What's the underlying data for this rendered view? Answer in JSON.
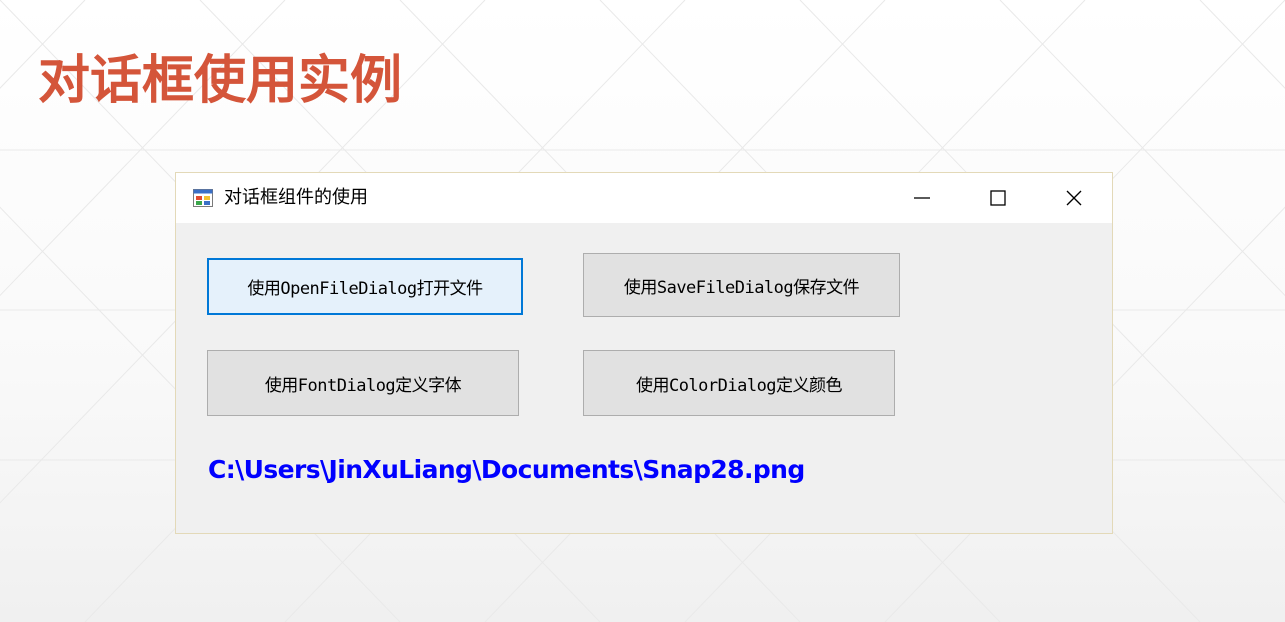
{
  "slide": {
    "title": "对话框使用实例"
  },
  "window": {
    "title": "对话框组件的使用",
    "icon": "winforms-app-icon",
    "controls": {
      "minimize": "minimize-icon",
      "maximize": "maximize-icon",
      "close": "close-icon"
    }
  },
  "buttons": {
    "open_file": "使用OpenFileDialog打开文件",
    "save_file": "使用SaveFileDialog保存文件",
    "font": "使用FontDialog定义字体",
    "color": "使用ColorDialog定义颜色"
  },
  "path_label": "C:\\Users\\JinXuLiang\\Documents\\Snap28.png",
  "colors": {
    "title_accent": "#d4553a",
    "path_text": "#0000ff",
    "focus_border": "#0078d7"
  }
}
